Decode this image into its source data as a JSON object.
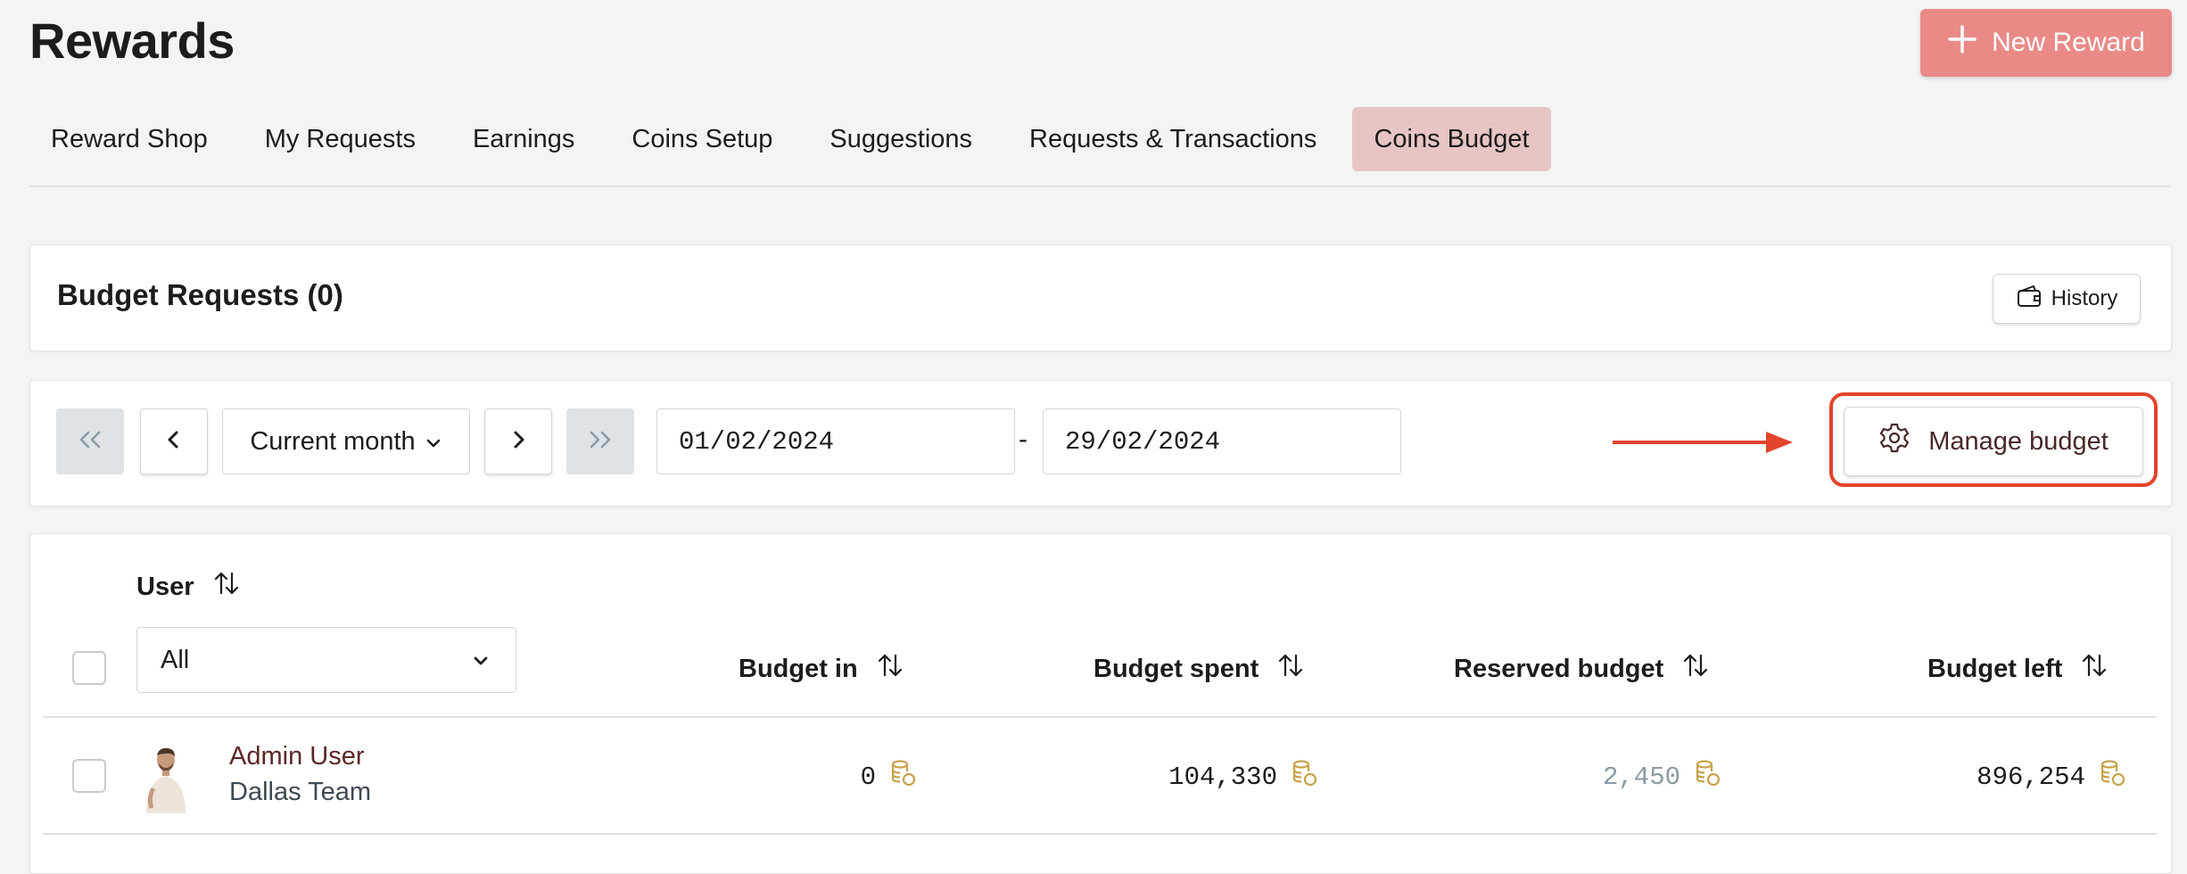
{
  "header": {
    "title": "Rewards",
    "new_reward_label": "New Reward"
  },
  "tabs": [
    {
      "label": "Reward Shop",
      "active": false
    },
    {
      "label": "My Requests",
      "active": false
    },
    {
      "label": "Earnings",
      "active": false
    },
    {
      "label": "Coins Setup",
      "active": false
    },
    {
      "label": "Suggestions",
      "active": false
    },
    {
      "label": "Requests & Transactions",
      "active": false
    },
    {
      "label": "Coins Budget",
      "active": true
    }
  ],
  "budget_requests": {
    "title": "Budget Requests (0)",
    "history_label": "History"
  },
  "filter": {
    "period_label": "Current month",
    "date_from": "01/02/2024",
    "date_separator": "-",
    "date_to": "29/02/2024",
    "manage_budget_label": "Manage budget"
  },
  "table": {
    "user_header": "User",
    "user_filter_value": "All",
    "columns": [
      "Budget in",
      "Budget spent",
      "Reserved budget",
      "Budget left"
    ],
    "rows": [
      {
        "name": "Admin User",
        "team": "Dallas Team",
        "budget_in": "0",
        "budget_spent": "104,330",
        "reserved_budget": "2,450",
        "budget_left": "896,254"
      }
    ]
  },
  "colors": {
    "accent": "#e98a87",
    "active_tab": "#e8c5c5",
    "highlight": "#e2442c",
    "coin": "#c8a24a",
    "reserved_text": "#8a9aa4"
  },
  "icons": [
    "plus-icon",
    "wallet-icon",
    "double-chevron-left-icon",
    "chevron-left-icon",
    "chevron-down-icon",
    "chevron-right-icon",
    "double-chevron-right-icon",
    "gear-icon",
    "sort-icon",
    "coins-icon",
    "arrow-right-icon"
  ]
}
